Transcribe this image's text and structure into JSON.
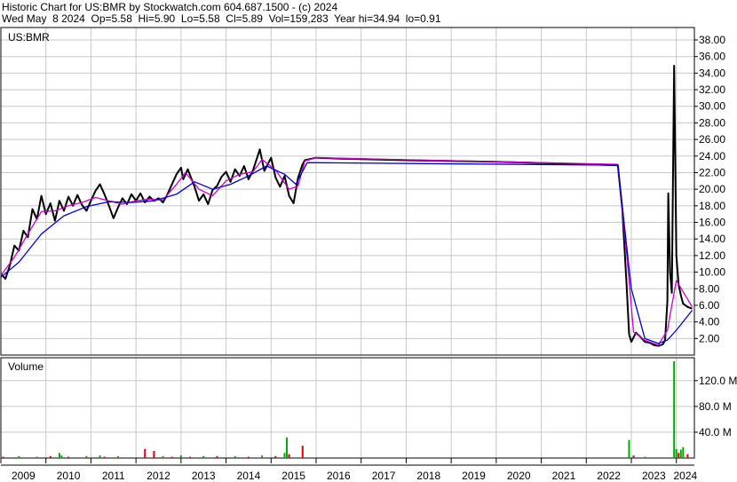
{
  "header": {
    "line1": "Historic Chart for US:BMR by Stockwatch.com 604.687.1500 - (c) 2024",
    "line2": "Wed May  8 2024  Op=5.58  Hi=5.90  Lo=5.58  Cl=5.89  Vol=159,283  Year hi=34.94  lo=0.91"
  },
  "colors": {
    "background": "#ffffff",
    "grid": "#c8c8c8",
    "price_bar": "#000000",
    "short_ma": "#cc00cc",
    "long_ma": "#0000cc",
    "volume_up": "#00aa00",
    "volume_down": "#dd0000"
  },
  "chart_data": {
    "type": "line",
    "title": "Historic Chart for US:BMR by Stockwatch.com 604.687.1500 - (c) 2024",
    "price_panel": {
      "label": "US:BMR",
      "ylim": [
        0,
        39.5
      ],
      "y_ticks": [
        "2.00",
        "4.00",
        "6.00",
        "8.00",
        "10.00",
        "12.00",
        "14.00",
        "16.00",
        "18.00",
        "20.00",
        "22.00",
        "24.00",
        "26.00",
        "28.00",
        "30.00",
        "32.00",
        "34.00",
        "36.00",
        "38.00"
      ],
      "y_tick_values": [
        2,
        4,
        6,
        8,
        10,
        12,
        14,
        16,
        18,
        20,
        22,
        24,
        26,
        28,
        30,
        32,
        34,
        36,
        38
      ],
      "series": [
        {
          "name": "price",
          "points": [
            [
              2009.0,
              9.8
            ],
            [
              2009.1,
              9.2
            ],
            [
              2009.2,
              10.8
            ],
            [
              2009.3,
              13.2
            ],
            [
              2009.4,
              12.6
            ],
            [
              2009.5,
              15.0
            ],
            [
              2009.6,
              14.2
            ],
            [
              2009.7,
              17.6
            ],
            [
              2009.8,
              16.4
            ],
            [
              2009.9,
              19.2
            ],
            [
              2010.0,
              17.0
            ],
            [
              2010.1,
              18.3
            ],
            [
              2010.2,
              16.2
            ],
            [
              2010.3,
              18.6
            ],
            [
              2010.4,
              17.4
            ],
            [
              2010.5,
              19.1
            ],
            [
              2010.6,
              18.0
            ],
            [
              2010.7,
              19.3
            ],
            [
              2010.8,
              18.1
            ],
            [
              2010.9,
              17.4
            ],
            [
              2011.0,
              18.6
            ],
            [
              2011.1,
              19.8
            ],
            [
              2011.2,
              20.6
            ],
            [
              2011.3,
              19.4
            ],
            [
              2011.4,
              18.0
            ],
            [
              2011.5,
              16.5
            ],
            [
              2011.6,
              17.8
            ],
            [
              2011.7,
              18.9
            ],
            [
              2011.8,
              18.2
            ],
            [
              2011.9,
              19.4
            ],
            [
              2012.0,
              18.6
            ],
            [
              2012.1,
              19.5
            ],
            [
              2012.2,
              18.4
            ],
            [
              2012.3,
              19.1
            ],
            [
              2012.4,
              18.6
            ],
            [
              2012.5,
              18.9
            ],
            [
              2012.6,
              18.4
            ],
            [
              2012.7,
              19.4
            ],
            [
              2012.8,
              20.6
            ],
            [
              2012.9,
              21.8
            ],
            [
              2013.0,
              22.6
            ],
            [
              2013.05,
              21.2
            ],
            [
              2013.15,
              22.4
            ],
            [
              2013.3,
              20.3
            ],
            [
              2013.4,
              18.6
            ],
            [
              2013.5,
              19.4
            ],
            [
              2013.6,
              18.2
            ],
            [
              2013.7,
              19.9
            ],
            [
              2013.8,
              20.4
            ],
            [
              2013.9,
              21.5
            ],
            [
              2014.0,
              22.1
            ],
            [
              2014.1,
              20.9
            ],
            [
              2014.2,
              22.4
            ],
            [
              2014.3,
              21.6
            ],
            [
              2014.4,
              22.8
            ],
            [
              2014.5,
              21.2
            ],
            [
              2014.6,
              22.3
            ],
            [
              2014.75,
              24.8
            ],
            [
              2014.85,
              22.2
            ],
            [
              2015.0,
              23.8
            ],
            [
              2015.1,
              21.4
            ],
            [
              2015.2,
              20.3
            ],
            [
              2015.3,
              21.6
            ],
            [
              2015.4,
              19.2
            ],
            [
              2015.5,
              18.3
            ],
            [
              2015.6,
              21.4
            ],
            [
              2015.7,
              23.0
            ],
            [
              2015.75,
              23.5
            ],
            [
              2016.0,
              23.8
            ],
            [
              2016.5,
              23.7
            ],
            [
              2018.0,
              23.5
            ],
            [
              2020.0,
              23.3
            ],
            [
              2022.0,
              23.0
            ],
            [
              2022.7,
              22.9
            ],
            [
              2022.8,
              17.5
            ],
            [
              2022.9,
              8.0
            ],
            [
              2022.95,
              2.5
            ],
            [
              2023.0,
              1.6
            ],
            [
              2023.1,
              2.7
            ],
            [
              2023.2,
              2.2
            ],
            [
              2023.3,
              1.6
            ],
            [
              2023.4,
              1.5
            ],
            [
              2023.5,
              1.2
            ],
            [
              2023.6,
              1.1
            ],
            [
              2023.7,
              1.3
            ],
            [
              2023.75,
              1.8
            ],
            [
              2023.8,
              6.5
            ],
            [
              2023.82,
              19.5
            ],
            [
              2023.86,
              10.0
            ],
            [
              2023.9,
              7.5
            ],
            [
              2023.95,
              34.9
            ],
            [
              2024.0,
              12.0
            ],
            [
              2024.05,
              8.5
            ],
            [
              2024.1,
              7.2
            ],
            [
              2024.15,
              6.2
            ],
            [
              2024.25,
              5.8
            ],
            [
              2024.35,
              5.6
            ]
          ]
        },
        {
          "name": "short_ma",
          "points": [
            [
              2009.0,
              9.6
            ],
            [
              2009.3,
              11.8
            ],
            [
              2009.6,
              14.6
            ],
            [
              2009.9,
              17.3
            ],
            [
              2010.2,
              17.4
            ],
            [
              2010.5,
              18.0
            ],
            [
              2010.8,
              18.4
            ],
            [
              2011.1,
              19.0
            ],
            [
              2011.4,
              18.6
            ],
            [
              2011.7,
              18.2
            ],
            [
              2012.0,
              18.6
            ],
            [
              2012.3,
              18.8
            ],
            [
              2012.6,
              18.7
            ],
            [
              2012.9,
              20.6
            ],
            [
              2013.1,
              22.0
            ],
            [
              2013.4,
              20.0
            ],
            [
              2013.7,
              19.2
            ],
            [
              2014.0,
              21.0
            ],
            [
              2014.3,
              21.8
            ],
            [
              2014.6,
              22.1
            ],
            [
              2014.8,
              23.6
            ],
            [
              2015.1,
              22.3
            ],
            [
              2015.4,
              20.0
            ],
            [
              2015.6,
              20.4
            ],
            [
              2015.75,
              23.4
            ],
            [
              2016.0,
              23.8
            ],
            [
              2022.7,
              23.0
            ],
            [
              2022.9,
              12.0
            ],
            [
              2023.05,
              2.8
            ],
            [
              2023.3,
              1.8
            ],
            [
              2023.6,
              1.2
            ],
            [
              2023.8,
              3.0
            ],
            [
              2024.0,
              9.0
            ],
            [
              2024.35,
              5.8
            ]
          ]
        },
        {
          "name": "long_ma",
          "points": [
            [
              2009.0,
              9.4
            ],
            [
              2009.4,
              11.2
            ],
            [
              2009.9,
              14.6
            ],
            [
              2010.4,
              16.8
            ],
            [
              2010.9,
              17.9
            ],
            [
              2011.4,
              18.5
            ],
            [
              2011.9,
              18.4
            ],
            [
              2012.4,
              18.6
            ],
            [
              2012.9,
              19.4
            ],
            [
              2013.3,
              20.9
            ],
            [
              2013.7,
              20.0
            ],
            [
              2014.1,
              20.6
            ],
            [
              2014.5,
              21.6
            ],
            [
              2014.9,
              22.8
            ],
            [
              2015.3,
              21.8
            ],
            [
              2015.55,
              20.6
            ],
            [
              2015.8,
              23.2
            ],
            [
              2016.0,
              23.2
            ],
            [
              2022.7,
              22.9
            ],
            [
              2023.0,
              8.0
            ],
            [
              2023.3,
              2.0
            ],
            [
              2023.6,
              1.4
            ],
            [
              2023.8,
              1.8
            ],
            [
              2024.0,
              3.0
            ],
            [
              2024.35,
              5.4
            ]
          ]
        }
      ]
    },
    "volume_panel": {
      "label": "Volume",
      "ylim": [
        0,
        150
      ],
      "y_ticks": [
        "40.0 M",
        "80.0 M",
        "120.0 M"
      ],
      "y_tick_values": [
        40,
        80,
        120
      ],
      "bars": [
        {
          "x": 2009.05,
          "value": 2,
          "dir": "down"
        },
        {
          "x": 2009.4,
          "value": 3,
          "dir": "up"
        },
        {
          "x": 2009.8,
          "value": 2,
          "dir": "up"
        },
        {
          "x": 2010.1,
          "value": 3,
          "dir": "down"
        },
        {
          "x": 2010.3,
          "value": 8,
          "dir": "up"
        },
        {
          "x": 2010.35,
          "value": 4,
          "dir": "up"
        },
        {
          "x": 2010.5,
          "value": 2,
          "dir": "down"
        },
        {
          "x": 2010.9,
          "value": 3,
          "dir": "up"
        },
        {
          "x": 2011.2,
          "value": 4,
          "dir": "up"
        },
        {
          "x": 2011.3,
          "value": 2,
          "dir": "down"
        },
        {
          "x": 2011.6,
          "value": 3,
          "dir": "up"
        },
        {
          "x": 2012.2,
          "value": 14,
          "dir": "down"
        },
        {
          "x": 2012.4,
          "value": 11,
          "dir": "down"
        },
        {
          "x": 2012.6,
          "value": 3,
          "dir": "up"
        },
        {
          "x": 2012.8,
          "value": 2,
          "dir": "down"
        },
        {
          "x": 2013.0,
          "value": 4,
          "dir": "up"
        },
        {
          "x": 2013.2,
          "value": 2,
          "dir": "down"
        },
        {
          "x": 2013.5,
          "value": 3,
          "dir": "up"
        },
        {
          "x": 2013.8,
          "value": 3,
          "dir": "down"
        },
        {
          "x": 2014.2,
          "value": 3,
          "dir": "up"
        },
        {
          "x": 2014.5,
          "value": 2,
          "dir": "down"
        },
        {
          "x": 2014.8,
          "value": 4,
          "dir": "up"
        },
        {
          "x": 2015.1,
          "value": 3,
          "dir": "down"
        },
        {
          "x": 2015.3,
          "value": 8,
          "dir": "up"
        },
        {
          "x": 2015.35,
          "value": 32,
          "dir": "up"
        },
        {
          "x": 2015.4,
          "value": 6,
          "dir": "down"
        },
        {
          "x": 2015.7,
          "value": 19,
          "dir": "down"
        },
        {
          "x": 2022.95,
          "value": 28,
          "dir": "up"
        },
        {
          "x": 2023.05,
          "value": 4,
          "dir": "down"
        },
        {
          "x": 2023.3,
          "value": 2,
          "dir": "up"
        },
        {
          "x": 2023.95,
          "value": 150,
          "dir": "up"
        },
        {
          "x": 2024.0,
          "value": 14,
          "dir": "up"
        },
        {
          "x": 2024.05,
          "value": 8,
          "dir": "down"
        },
        {
          "x": 2024.1,
          "value": 13,
          "dir": "up"
        },
        {
          "x": 2024.15,
          "value": 17,
          "dir": "up"
        },
        {
          "x": 2024.25,
          "value": 6,
          "dir": "down"
        }
      ]
    },
    "x_axis": {
      "ticks": [
        "2009",
        "2010",
        "2011",
        "2012",
        "2013",
        "2014",
        "2015",
        "2016",
        "2017",
        "2018",
        "2019",
        "2020",
        "2021",
        "2022",
        "2023",
        "2024"
      ],
      "tick_values": [
        2009,
        2010,
        2011,
        2012,
        2013,
        2014,
        2015,
        2016,
        2017,
        2018,
        2019,
        2020,
        2021,
        2022,
        2023,
        2024
      ],
      "xlim": [
        2009,
        2024.4
      ]
    },
    "grid": true
  }
}
